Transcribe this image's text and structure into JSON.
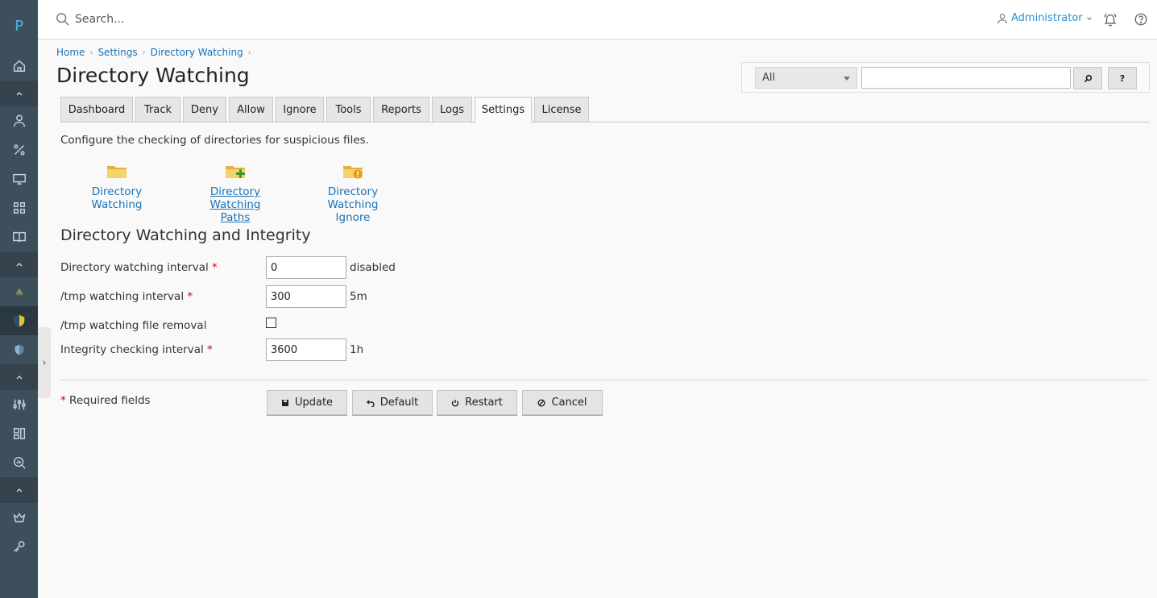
{
  "sidebar": {
    "logo": "P",
    "icons": [
      "home-icon",
      "user-icon",
      "percent-icon",
      "monitor-icon",
      "grid-icon",
      "book-icon",
      "gnome-icon",
      "shield-icon",
      "shield-small-icon",
      "sliders-icon",
      "layout-icon",
      "search-chart-icon",
      "crown-icon",
      "key-icon"
    ]
  },
  "topbar": {
    "search_placeholder": "Search...",
    "user_name": "Administrator"
  },
  "breadcrumb": [
    "Home",
    "Settings",
    "Directory Watching"
  ],
  "page": {
    "title": "Directory Watching",
    "description": "Configure the checking of directories for suspicious files."
  },
  "filter": {
    "selected": "All",
    "search_button": "⌕",
    "help_button": "?"
  },
  "tabs": [
    "Dashboard",
    "Track",
    "Deny",
    "Allow",
    "Ignore",
    "Tools",
    "Reports",
    "Logs",
    "Settings",
    "License"
  ],
  "active_tab": "Settings",
  "shortcuts": [
    {
      "line1": "Directory Watching",
      "line2": ""
    },
    {
      "line1": "Directory Watching",
      "line2": "Paths"
    },
    {
      "line1": "Directory Watching",
      "line2": "Ignore"
    }
  ],
  "section": {
    "title": "Directory Watching and Integrity",
    "fields": [
      {
        "label": "Directory watching interval",
        "required": "*",
        "value": "0",
        "unit": "disabled"
      },
      {
        "label": "/tmp watching interval",
        "required": "*",
        "value": "300",
        "unit": "5m"
      },
      {
        "label": "/tmp watching file removal",
        "required": "",
        "checked": false
      },
      {
        "label": "Integrity checking interval",
        "required": "*",
        "value": "3600",
        "unit": "1h"
      }
    ]
  },
  "required_note": {
    "star": "*",
    "text": "Required fields"
  },
  "buttons": {
    "update": "Update",
    "default": "Default",
    "restart": "Restart",
    "cancel": "Cancel"
  }
}
